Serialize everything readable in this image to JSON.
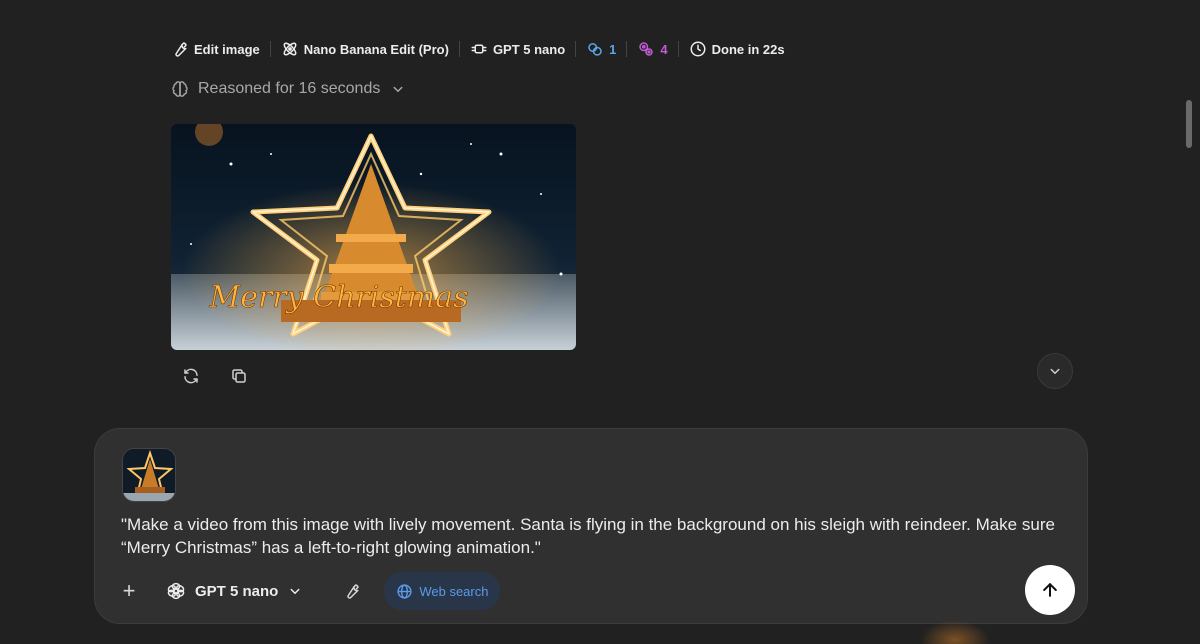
{
  "meta": {
    "edit_image": "Edit image",
    "tool": "Nano Banana Edit (Pro)",
    "model": "GPT 5 nano",
    "count_blue": "1",
    "count_purple": "4",
    "done": "Done in 22s"
  },
  "reasoning": {
    "label": "Reasoned for 16 seconds"
  },
  "image": {
    "caption_art": "Merry Christmas"
  },
  "composer": {
    "prompt_parts": [
      "\"Make a video from this image with lively movement. Santa is flying in the background on his sleigh with reindeer. Make sure “Merry Christmas” has a left-to-right glowing animation.\""
    ],
    "model_label": "GPT 5 nano",
    "web_search_label": "Web search"
  },
  "colors": {
    "background": "#212121",
    "composer_bg": "#303030",
    "accent_blue": "#5ba4e6",
    "accent_purple": "#c35bd6",
    "spellcheck": "#d93a3a"
  }
}
